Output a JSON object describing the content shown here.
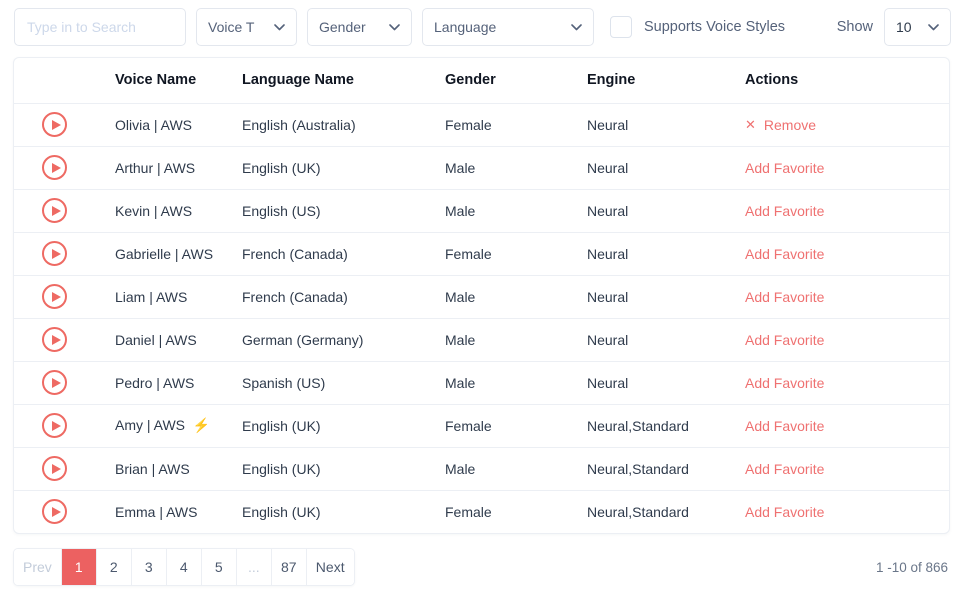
{
  "colors": {
    "accent": "#ec6161",
    "link": "#ef7171",
    "play_icon": "#ee6a63",
    "border": "#eceff4",
    "text": "#2f3b4c",
    "muted": "#55627a"
  },
  "toolbar": {
    "search": {
      "value": "",
      "placeholder": "Type in to Search"
    },
    "voice_type_select": {
      "label": "Voice T",
      "icon": "chevron-down-icon"
    },
    "gender_select": {
      "label": "Gender",
      "icon": "chevron-down-icon"
    },
    "language_select": {
      "label": "Language",
      "icon": "chevron-down-icon"
    },
    "supports_voice_styles": {
      "label": "Supports Voice Styles",
      "checked": false
    },
    "show_label": "Show",
    "show_select": {
      "label": "10",
      "icon": "chevron-down-icon"
    }
  },
  "table": {
    "columns": [
      "",
      "Voice Name",
      "Language Name",
      "Gender",
      "Engine",
      "Actions"
    ],
    "rows": [
      {
        "play": "play-icon",
        "voice": "Olivia | AWS \u0001",
        "language": "English (Australia)",
        "gender": "Female",
        "engine": "Neural",
        "action": "Remove",
        "action_icon": "close-icon",
        "favorited": true
      },
      {
        "play": "play-icon",
        "voice": "Arthur | AWS \u0001",
        "language": "English (UK)",
        "gender": "Male",
        "engine": "Neural",
        "action": "Add Favorite",
        "action_icon": "",
        "favorited": false
      },
      {
        "play": "play-icon",
        "voice": "Kevin | AWS \u0001",
        "language": "English (US)",
        "gender": "Male",
        "engine": "Neural",
        "action": "Add Favorite",
        "action_icon": "",
        "favorited": false
      },
      {
        "play": "play-icon",
        "voice": "Gabrielle | AWS \u0001",
        "language": "French (Canada)",
        "gender": "Female",
        "engine": "Neural",
        "action": "Add Favorite",
        "action_icon": "",
        "favorited": false
      },
      {
        "play": "play-icon",
        "voice": "Liam | AWS \u0001",
        "language": "French (Canada)",
        "gender": "Male",
        "engine": "Neural",
        "action": "Add Favorite",
        "action_icon": "",
        "favorited": false
      },
      {
        "play": "play-icon",
        "voice": "Daniel | AWS \u0001",
        "language": "German (Germany)",
        "gender": "Male",
        "engine": "Neural",
        "action": "Add Favorite",
        "action_icon": "",
        "favorited": false
      },
      {
        "play": "play-icon",
        "voice": "Pedro | AWS \u0001",
        "language": "Spanish (US)",
        "gender": "Male",
        "engine": "Neural",
        "action": "Add Favorite",
        "action_icon": "",
        "favorited": false
      },
      {
        "play": "play-icon",
        "voice": "Amy | AWS \u0001 ⚡",
        "language": "English (UK)",
        "gender": "Female",
        "engine": "Neural,Standard",
        "action": "Add Favorite",
        "action_icon": "",
        "favorited": false
      },
      {
        "play": "play-icon",
        "voice": "Brian | AWS \u0001",
        "language": "English (UK)",
        "gender": "Male",
        "engine": "Neural,Standard",
        "action": "Add Favorite",
        "action_icon": "",
        "favorited": false
      },
      {
        "play": "play-icon",
        "voice": "Emma | AWS \u0001",
        "language": "English (UK)",
        "gender": "Female",
        "engine": "Neural,Standard",
        "action": "Add Favorite",
        "action_icon": "",
        "favorited": false
      }
    ]
  },
  "pagination": {
    "items": [
      {
        "label": "Prev",
        "state": "disabled"
      },
      {
        "label": "1",
        "state": "active"
      },
      {
        "label": "2",
        "state": "normal"
      },
      {
        "label": "3",
        "state": "normal"
      },
      {
        "label": "4",
        "state": "normal"
      },
      {
        "label": "5",
        "state": "normal"
      },
      {
        "label": "...",
        "state": "gap"
      },
      {
        "label": "87",
        "state": "normal"
      },
      {
        "label": "Next",
        "state": "normal"
      }
    ],
    "count_text": "1 -10 of 866"
  }
}
